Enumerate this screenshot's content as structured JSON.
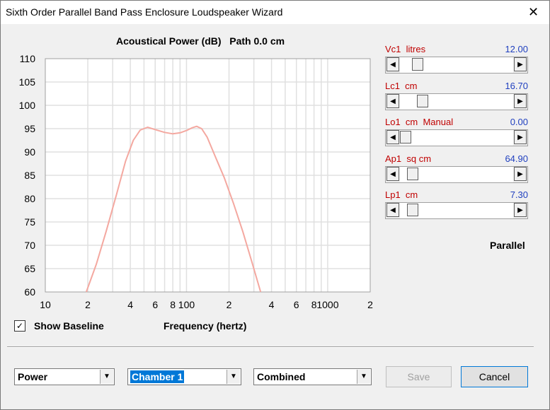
{
  "window": {
    "title": "Sixth Order Parallel Band Pass Enclosure Loudspeaker Wizard",
    "close_glyph": "✕"
  },
  "chart_title": "Acoustical Power (dB)   Path 0.0 cm",
  "params": [
    {
      "label": "Vc1  litres",
      "value": "12.00",
      "thumb_fraction": 0.12
    },
    {
      "label": "Lc1  cm",
      "value": "16.70",
      "thumb_fraction": 0.17
    },
    {
      "label": "Lo1  cm  Manual",
      "value": "0.00",
      "thumb_fraction": 0.0
    },
    {
      "label": "Ap1  sq cm",
      "value": "64.90",
      "thumb_fraction": 0.07
    },
    {
      "label": "Lp1  cm",
      "value": "7.30",
      "thumb_fraction": 0.07
    }
  ],
  "mode_label": "Parallel",
  "show_baseline": {
    "label": "Show Baseline",
    "checked": true,
    "check_glyph": "✓"
  },
  "dropdowns": [
    {
      "value": "Power",
      "selected": false
    },
    {
      "value": "Chamber 1",
      "selected": true
    },
    {
      "value": "Combined",
      "selected": false
    }
  ],
  "buttons": {
    "save": "Save",
    "cancel": "Cancel"
  },
  "chart_data": {
    "type": "line",
    "title": "Acoustical Power (dB)   Path 0.0 cm",
    "xlabel": "Frequency (hertz)",
    "ylabel": "",
    "x_scale": "log",
    "xlim": [
      10,
      2000
    ],
    "ylim": [
      60,
      110
    ],
    "yticks": [
      60,
      65,
      70,
      75,
      80,
      85,
      90,
      95,
      100,
      105,
      110
    ],
    "xtick_labels": [
      {
        "x": 10,
        "label": "10"
      },
      {
        "x": 20,
        "label": "2"
      },
      {
        "x": 40,
        "label": "4"
      },
      {
        "x": 60,
        "label": "6"
      },
      {
        "x": 80,
        "label": "8"
      },
      {
        "x": 100,
        "label": "100"
      },
      {
        "x": 200,
        "label": "2"
      },
      {
        "x": 400,
        "label": "4"
      },
      {
        "x": 600,
        "label": "6"
      },
      {
        "x": 800,
        "label": "8"
      },
      {
        "x": 1000,
        "label": "1000"
      },
      {
        "x": 2000,
        "label": "2"
      }
    ],
    "grid": true,
    "series": [
      {
        "color": "#f4a8a0",
        "points": [
          [
            19.5,
            60
          ],
          [
            23,
            66
          ],
          [
            27,
            73
          ],
          [
            32,
            81
          ],
          [
            37,
            88
          ],
          [
            42,
            92.5
          ],
          [
            47,
            94.7
          ],
          [
            53,
            95.3
          ],
          [
            60,
            94.8
          ],
          [
            70,
            94.2
          ],
          [
            80,
            93.9
          ],
          [
            90,
            94.1
          ],
          [
            100,
            94.6
          ],
          [
            110,
            95.2
          ],
          [
            118,
            95.5
          ],
          [
            128,
            95.0
          ],
          [
            140,
            93.2
          ],
          [
            160,
            89
          ],
          [
            185,
            84.5
          ],
          [
            215,
            79
          ],
          [
            250,
            73
          ],
          [
            290,
            66.5
          ],
          [
            335,
            60
          ]
        ]
      }
    ]
  }
}
